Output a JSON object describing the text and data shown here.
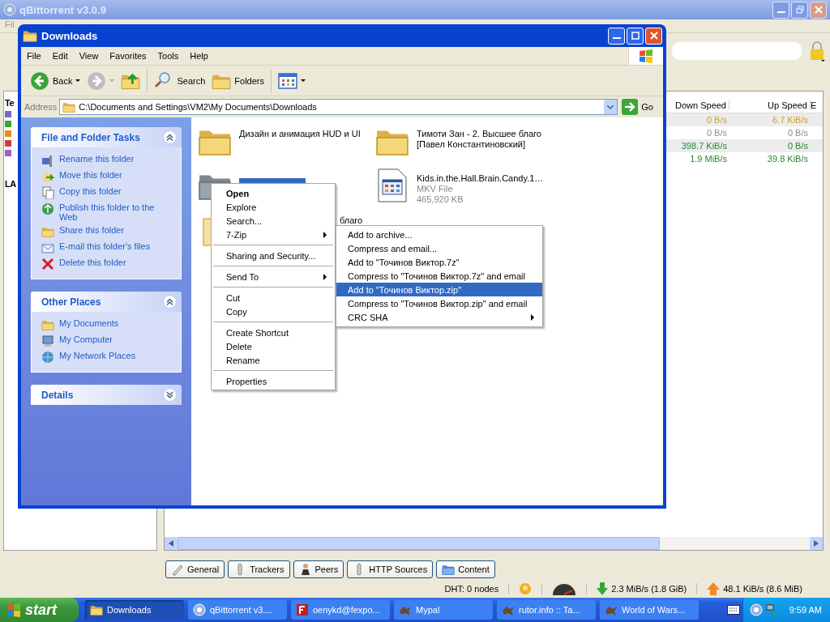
{
  "qbittorrent": {
    "title": "qBittorrent v3.0.9",
    "menu": [
      "Fil"
    ],
    "sidebar_fragments": [
      "Te",
      "LA"
    ],
    "columns": [
      "Down Speed",
      "Up Speed",
      "E"
    ],
    "rows": [
      {
        "down_speed": "0 B/s",
        "up_speed": "6.7 KiB/s",
        "color": "#c8a030"
      },
      {
        "down_speed": "0 B/s",
        "up_speed": "0 B/s",
        "color": "#8c8c8c"
      },
      {
        "down_speed": "398.7 KiB/s",
        "up_speed": "0 B/s",
        "color": "#2a862a"
      },
      {
        "down_speed": "1.9 MiB/s",
        "up_speed": "39.8 KiB/s",
        "color": "#2a862a"
      }
    ],
    "detail_tabs": [
      "General",
      "Trackers",
      "Peers",
      "HTTP Sources",
      "Content"
    ],
    "status_bar": {
      "dht": "DHT: 0 nodes",
      "download": "2.3 MiB/s (1.8 GiB)",
      "upload": "48.1 KiB/s (8.6 MiB)"
    }
  },
  "explorer": {
    "title": "Downloads",
    "menu": [
      "File",
      "Edit",
      "View",
      "Favorites",
      "Tools",
      "Help"
    ],
    "toolbar": {
      "back": "Back",
      "search": "Search",
      "folders": "Folders"
    },
    "address": {
      "label": "Address",
      "path": "C:\\Documents and Settings\\VM2\\My Documents\\Downloads",
      "go": "Go"
    },
    "task_panels": [
      {
        "title": "File and Folder Tasks",
        "expanded": true,
        "items": [
          "Rename this folder",
          "Move this folder",
          "Copy this folder",
          "Publish this folder to the Web",
          "Share this folder",
          "E-mail this folder's files",
          "Delete this folder"
        ]
      },
      {
        "title": "Other Places",
        "expanded": true,
        "items": [
          "My Documents",
          "My Computer",
          "My Network Places"
        ]
      },
      {
        "title": "Details",
        "expanded": false
      }
    ],
    "files": [
      {
        "kind": "folder",
        "name": "Дизайн и анимация HUD и UI",
        "selected": false
      },
      {
        "kind": "folder",
        "name": "Тимоти Зан - 2. Высшее благо [Павел Константиновский]",
        "selected": false
      },
      {
        "kind": "folder",
        "selected": true
      },
      {
        "kind": "video",
        "name": "Kids.in.the.Hall.Brain.Candy.1…",
        "type": "MKV File",
        "size": "465,920 KB",
        "selected": false
      },
      {
        "kind": "archive",
        "name": "благо",
        "selected": false
      }
    ]
  },
  "context_menu": {
    "groups": [
      [
        {
          "label": "Open",
          "default": true,
          "submenu": false
        },
        {
          "label": "Explore",
          "default": false,
          "submenu": false
        },
        {
          "label": "Search...",
          "default": false,
          "submenu": false
        },
        {
          "label": "7-Zip",
          "default": false,
          "submenu": true
        }
      ],
      [
        {
          "label": "Sharing and Security...",
          "default": false,
          "submenu": false
        }
      ],
      [
        {
          "label": "Send To",
          "default": false,
          "submenu": true
        }
      ],
      [
        {
          "label": "Cut",
          "default": false,
          "submenu": false
        },
        {
          "label": "Copy",
          "default": false,
          "submenu": false
        }
      ],
      [
        {
          "label": "Create Shortcut",
          "default": false,
          "submenu": false
        },
        {
          "label": "Delete",
          "default": false,
          "submenu": false
        },
        {
          "label": "Rename",
          "default": false,
          "submenu": false
        }
      ],
      [
        {
          "label": "Properties",
          "default": false,
          "submenu": false
        }
      ]
    ]
  },
  "submenu": {
    "items": [
      {
        "label": "Add to archive...",
        "selected": false,
        "submenu": false
      },
      {
        "label": "Compress and email...",
        "selected": false,
        "submenu": false
      },
      {
        "label": "Add to \"Точинов Виктор.7z\"",
        "selected": false,
        "submenu": false
      },
      {
        "label": "Compress to \"Точинов Виктор.7z\" and email",
        "selected": false,
        "submenu": false
      },
      {
        "label": "Add to \"Точинов Виктор.zip\"",
        "selected": true,
        "submenu": false
      },
      {
        "label": "Compress to \"Точинов Виктор.zip\" and email",
        "selected": false,
        "submenu": false
      },
      {
        "label": "CRC SHA",
        "selected": false,
        "submenu": true
      }
    ]
  },
  "taskbar": {
    "start": "start",
    "tasks": [
      {
        "label": "Downloads",
        "selected": true
      },
      {
        "label": "qBittorrent v3....",
        "selected": false
      },
      {
        "label": "oenykd@fexpo...",
        "selected": false
      },
      {
        "label": "Mypal",
        "selected": false
      },
      {
        "label": "rutor.info :: Ta...",
        "selected": false
      },
      {
        "label": "World of Wars...",
        "selected": false
      }
    ],
    "clock": "9:59 AM"
  }
}
